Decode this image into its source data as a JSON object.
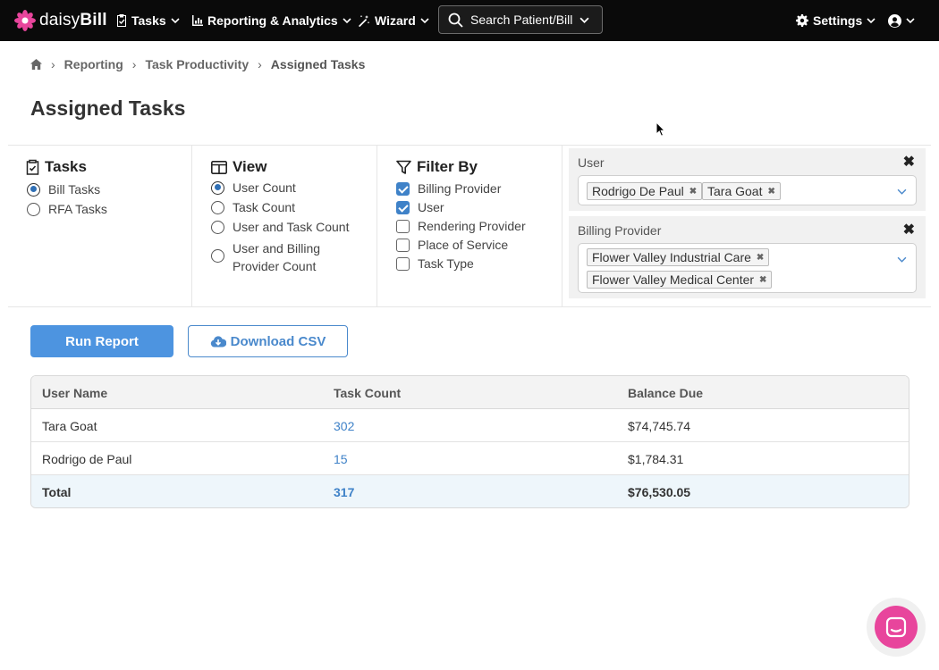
{
  "nav": {
    "brand_light": "daisy",
    "brand_bold": "Bill",
    "tasks": "Tasks",
    "reporting": "Reporting & Analytics",
    "wizard": "Wizard",
    "search": "Search Patient/Bill",
    "settings": "Settings"
  },
  "breadcrumb": [
    "Reporting",
    "Task Productivity",
    "Assigned Tasks"
  ],
  "page_title": "Assigned Tasks",
  "tasks_group": {
    "title": "Tasks",
    "options": [
      "Bill Tasks",
      "RFA Tasks"
    ],
    "selected": "Bill Tasks"
  },
  "view_group": {
    "title": "View",
    "options": [
      "User Count",
      "Task Count",
      "User and Task Count",
      "User and Billing",
      "Provider Count"
    ],
    "selected": "User Count"
  },
  "filter_group": {
    "title": "Filter By",
    "options": [
      {
        "label": "Billing Provider",
        "checked": true
      },
      {
        "label": "User",
        "checked": true
      },
      {
        "label": "Rendering Provider",
        "checked": false
      },
      {
        "label": "Place of Service",
        "checked": false
      },
      {
        "label": "Task Type",
        "checked": false
      }
    ]
  },
  "user_filter": {
    "label": "User",
    "tags": [
      "Rodrigo De Paul",
      "Tara Goat"
    ]
  },
  "provider_filter": {
    "label": "Billing Provider",
    "tags": [
      "Flower Valley Industrial Care",
      "Flower Valley Medical Center"
    ]
  },
  "actions": {
    "run": "Run Report",
    "download": "Download CSV"
  },
  "table": {
    "headers": [
      "User Name",
      "Task Count",
      "Balance Due"
    ],
    "rows": [
      [
        "Tara Goat",
        "302",
        "$74,745.74"
      ],
      [
        "Rodrigo de Paul",
        "15",
        "$1,784.31"
      ]
    ],
    "total": [
      "Total",
      "317",
      "$76,530.05"
    ]
  },
  "colors": {
    "nav_bg": "#0a0a0a",
    "primary": "#4d94e0",
    "link": "#3f82c8",
    "chat": "#e8459c",
    "total_row": "#eef6fb"
  }
}
